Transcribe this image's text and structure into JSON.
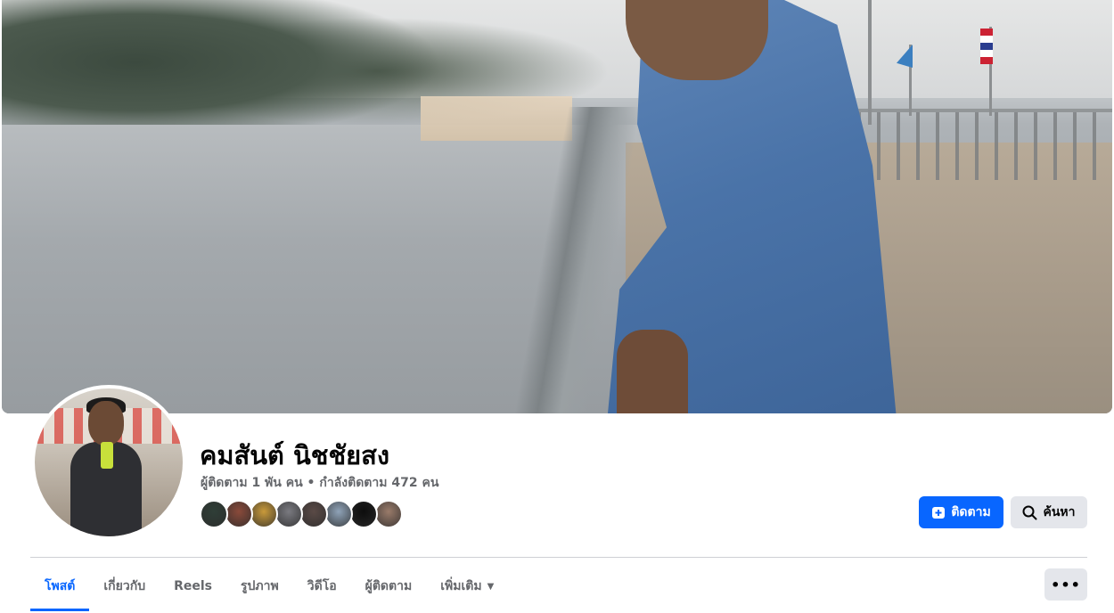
{
  "profile": {
    "name": "คมสันต์ นิชชัยสง",
    "stats": "ผู้ติดตาม 1 พัน คน • กำลังติดตาม 472 คน"
  },
  "friends": [
    {
      "color": "#2f3e37"
    },
    {
      "color": "#8a4a3a"
    },
    {
      "color": "#c99a3a"
    },
    {
      "color": "#7a7a80"
    },
    {
      "color": "#5a4a46"
    },
    {
      "color": "#8fa3b8"
    },
    {
      "color": "#0d0d0d"
    },
    {
      "color": "#9a7b6a"
    }
  ],
  "buttons": {
    "follow_label": "ติดตาม",
    "search_label": "ค้นหา",
    "more_label": "•••",
    "follow_color": "#0866ff",
    "follow_icon": "follow-icon",
    "search_icon": "search-icon"
  },
  "tabs": [
    {
      "label": "โพสต์",
      "active": true
    },
    {
      "label": "เกี่ยวกับ",
      "active": false
    },
    {
      "label": "Reels",
      "active": false
    },
    {
      "label": "รูปภาพ",
      "active": false
    },
    {
      "label": "วิดีโอ",
      "active": false
    },
    {
      "label": "ผู้ติดตาม",
      "active": false
    },
    {
      "label": "เพิ่มเติม",
      "active": false,
      "dropdown": true
    }
  ]
}
